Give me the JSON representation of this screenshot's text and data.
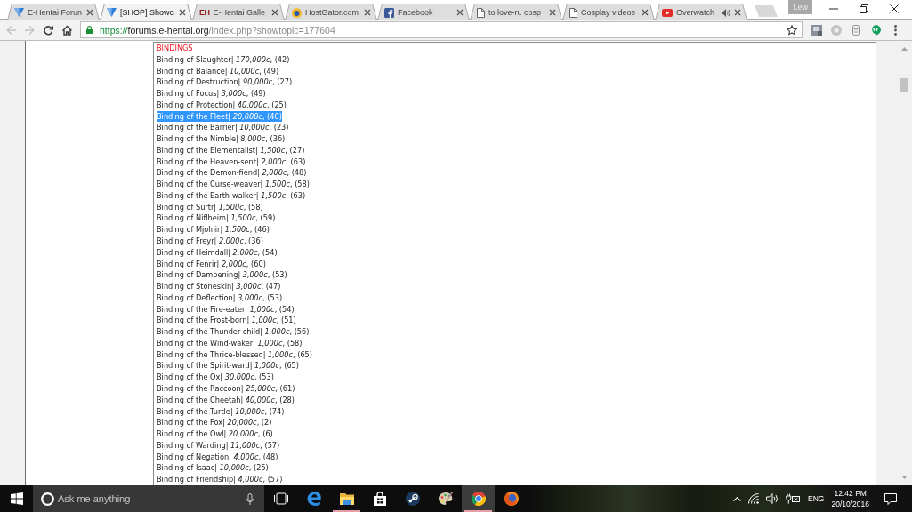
{
  "window": {
    "profile": "Lew"
  },
  "tabs": [
    {
      "title": "E-Hentai Forun",
      "kind": "forum",
      "selected": false,
      "audio": false
    },
    {
      "title": "[SHOP] Showc",
      "kind": "forum",
      "selected": true,
      "audio": false
    },
    {
      "title": "E-Hentai Galle",
      "kind": "letters",
      "icon_text": "EH",
      "selected": false,
      "audio": false
    },
    {
      "title": "HostGator.com",
      "kind": "round",
      "selected": false,
      "audio": false
    },
    {
      "title": "Facebook",
      "kind": "facebook",
      "selected": false,
      "audio": false
    },
    {
      "title": "to love-ru cosp",
      "kind": "page",
      "selected": false,
      "audio": false
    },
    {
      "title": "Cosplay videos",
      "kind": "page",
      "selected": false,
      "audio": false
    },
    {
      "title": "Overwatch",
      "kind": "video",
      "selected": false,
      "audio": true
    }
  ],
  "toolbar": {
    "back": {
      "disabled": true
    },
    "forward": {
      "disabled": true
    },
    "url": {
      "scheme": "https://",
      "host": "forums.e-hentai.org",
      "path": "/index.php?showtopic=177604"
    },
    "extensions": [
      {
        "kind": "tile"
      },
      {
        "kind": "circle"
      },
      {
        "kind": "robot"
      },
      {
        "kind": "chat"
      }
    ]
  },
  "page": {
    "heading": "BINDINGS",
    "items": [
      {
        "text": "Binding of Slaughter| *170,000c*, (42)",
        "highlighted": false
      },
      {
        "text": "Binding of Balance| *10,000c*, (49)",
        "highlighted": false
      },
      {
        "text": "Binding of Destruction| *90,000c*, (27)",
        "highlighted": false
      },
      {
        "text": "Binding of Focus| *3,000c*, (49)",
        "highlighted": false
      },
      {
        "text": "Binding of Protection| *40,000c*, (25)",
        "highlighted": false
      },
      {
        "text": "Binding of the Fleet| *20,000c*, (40)",
        "highlighted": true
      },
      {
        "text": "Binding of the Barrier| *10,000c*, (23)",
        "highlighted": false
      },
      {
        "text": "Binding of the Nimble| *8,000c*, (36)",
        "highlighted": false
      },
      {
        "text": "Binding of the Elementalist| *1,500c*, (27)",
        "highlighted": false
      },
      {
        "text": "Binding of the Heaven-sent| *2,000c*, (63)",
        "highlighted": false
      },
      {
        "text": "Binding of the Demon-fiend| *2,000c*, (48)",
        "highlighted": false
      },
      {
        "text": "Binding of the Curse-weaver| *1,500c*, (58)",
        "highlighted": false
      },
      {
        "text": "Binding of the Earth-walker| *1,500c*, (63)",
        "highlighted": false
      },
      {
        "text": "Binding of Surtr| *1,500c*, (58)",
        "highlighted": false
      },
      {
        "text": "Binding of Niflheim| *1,500c*, (59)",
        "highlighted": false
      },
      {
        "text": "Binding of Mjolnir| *1,500c*, (46)",
        "highlighted": false
      },
      {
        "text": "Binding of Freyr| *2,000c*, (36)",
        "highlighted": false
      },
      {
        "text": "Binding of Heimdall| *2,000c*, (54)",
        "highlighted": false
      },
      {
        "text": "Binding of Fenrir| *2,000c*, (60)",
        "highlighted": false
      },
      {
        "text": "Binding of Dampening| *3,000c*, (53)",
        "highlighted": false
      },
      {
        "text": "Binding of Stoneskin| *3,000c*, (47)",
        "highlighted": false
      },
      {
        "text": "Binding of Deflection| *3,000c*, (53)",
        "highlighted": false
      },
      {
        "text": "Binding of the Fire-eater| *1,000c*, (54)",
        "highlighted": false
      },
      {
        "text": "Binding of the Frost-born| *1,000c*, (51)",
        "highlighted": false
      },
      {
        "text": "Binding of the Thunder-child| *1,000c*, (56)",
        "highlighted": false
      },
      {
        "text": "Binding of the Wind-waker| *1,000c*, (58)",
        "highlighted": false
      },
      {
        "text": "Binding of the Thrice-blessed| *1,000c*, (65)",
        "highlighted": false
      },
      {
        "text": "Binding of the Spirit-ward| *1,000c*, (65)",
        "highlighted": false
      },
      {
        "text": "Binding of the Ox| *30,000c*, (53)",
        "highlighted": false
      },
      {
        "text": "Binding of the Raccoon| *25,000c*, (61)",
        "highlighted": false
      },
      {
        "text": "Binding of the Cheetah| *40,000c*, (28)",
        "highlighted": false
      },
      {
        "text": "Binding of the Turtle| *10,000c*, (74)",
        "highlighted": false
      },
      {
        "text": "Binding of the Fox| *20,000c*, (2)",
        "highlighted": false
      },
      {
        "text": "Binding of the Owl| *20,000c*, (6)",
        "highlighted": false
      },
      {
        "text": "Binding of Warding| *11,000c*, (57)",
        "highlighted": false
      },
      {
        "text": "Binding of Negation| *4,000c*, (48)",
        "highlighted": false
      },
      {
        "text": "Binding of Isaac| *10,000c*, (25)",
        "highlighted": false
      },
      {
        "text": "Binding of Friendship| *4,000c*, (57)",
        "highlighted": false
      }
    ]
  },
  "taskbar": {
    "search": {
      "placeholder": "Ask me anything"
    },
    "apps": [
      {
        "kind": "task-view",
        "running": false,
        "active": false
      },
      {
        "kind": "edge",
        "running": false,
        "active": false
      },
      {
        "kind": "explorer",
        "running": true,
        "active": false
      },
      {
        "kind": "store",
        "running": false,
        "active": false
      },
      {
        "kind": "steam",
        "running": false,
        "active": false
      },
      {
        "kind": "paint",
        "running": false,
        "active": false
      },
      {
        "kind": "chrome",
        "running": true,
        "active": true
      },
      {
        "kind": "firefox",
        "running": false,
        "active": false
      }
    ],
    "tray": {
      "language": "ENG",
      "time": "12:42 PM",
      "date": "20/10/2016"
    }
  }
}
